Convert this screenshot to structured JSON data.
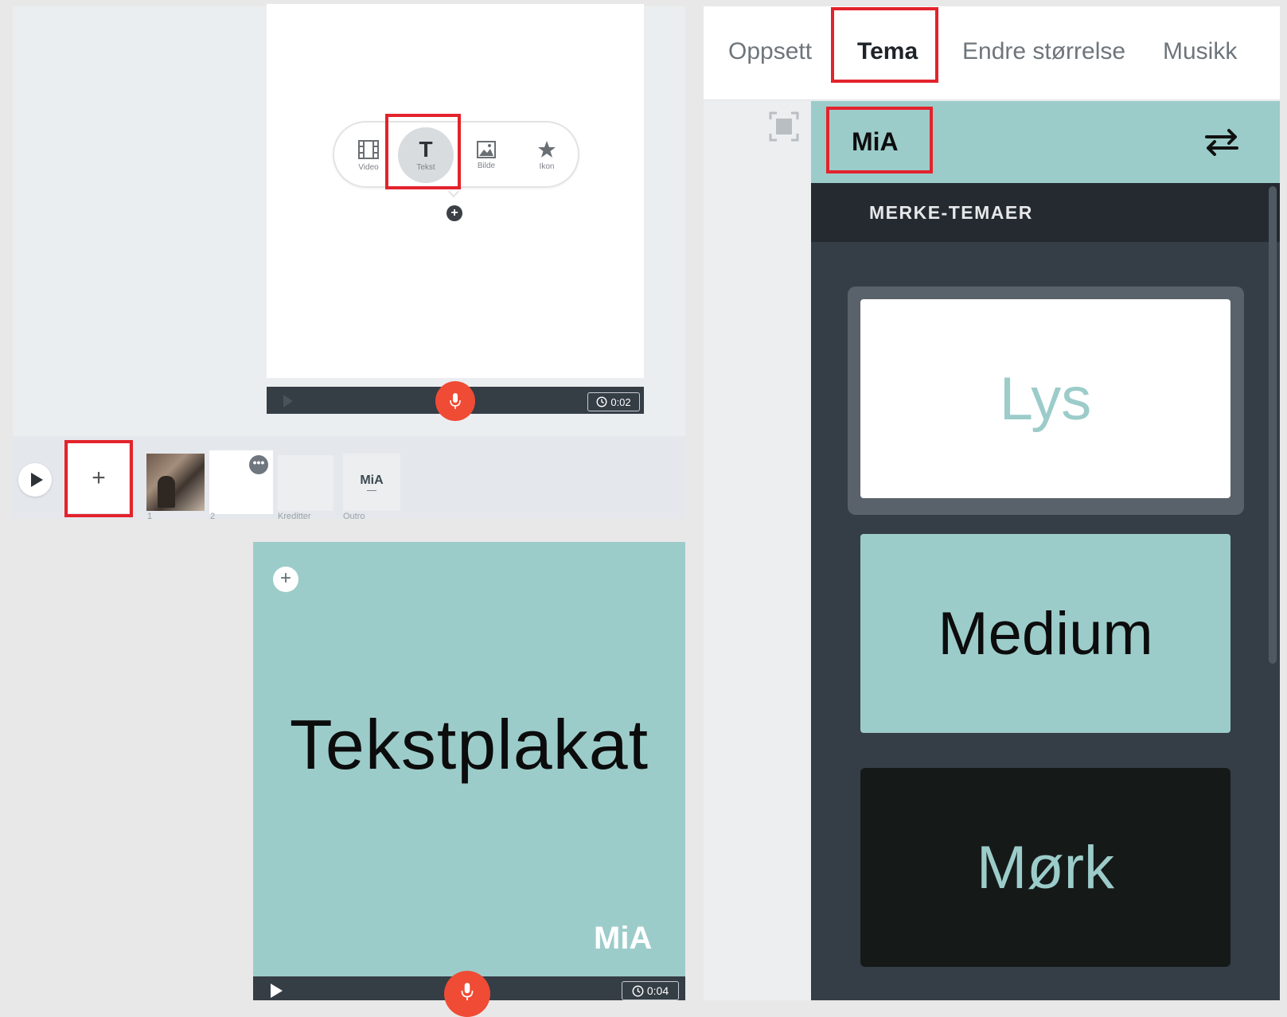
{
  "editor_top": {
    "popup_menu": {
      "items": [
        {
          "label": "Video",
          "icon": "film-icon"
        },
        {
          "label": "Tekst",
          "icon": "text-t-icon"
        },
        {
          "label": "Bilde",
          "icon": "image-icon"
        },
        {
          "label": "Ikon",
          "icon": "star-icon"
        }
      ]
    },
    "add_glyph": "+",
    "duration": "0:02"
  },
  "timeline": {
    "add_label": "+",
    "more_glyph": "•••",
    "slides": [
      {
        "caption": "1"
      },
      {
        "caption": "2"
      },
      {
        "caption": "Kreditter"
      },
      {
        "caption": "Outro",
        "thumb_text": "MiA"
      }
    ]
  },
  "editor_bottom": {
    "add_glyph": "+",
    "title": "Tekstplakat",
    "logo": "MiA",
    "duration": "0:04",
    "bg_color": "#9cccca"
  },
  "right_panel": {
    "tabs": [
      {
        "label": "Oppsett",
        "active": false
      },
      {
        "label": "Tema",
        "active": true
      },
      {
        "label": "Endre størrelse",
        "active": false
      },
      {
        "label": "Musikk",
        "active": false
      }
    ],
    "theme_name": "MiA",
    "section_title": "MERKE-TEMAER",
    "theme_options": [
      {
        "label": "Lys",
        "selected": true
      },
      {
        "label": "Medium",
        "selected": false
      },
      {
        "label": "Mørk",
        "selected": false
      }
    ]
  },
  "colors": {
    "accent_teal": "#9cccca",
    "record_red": "#f04b35",
    "highlight_red": "#e3232c",
    "dark_panel": "#353e47"
  }
}
